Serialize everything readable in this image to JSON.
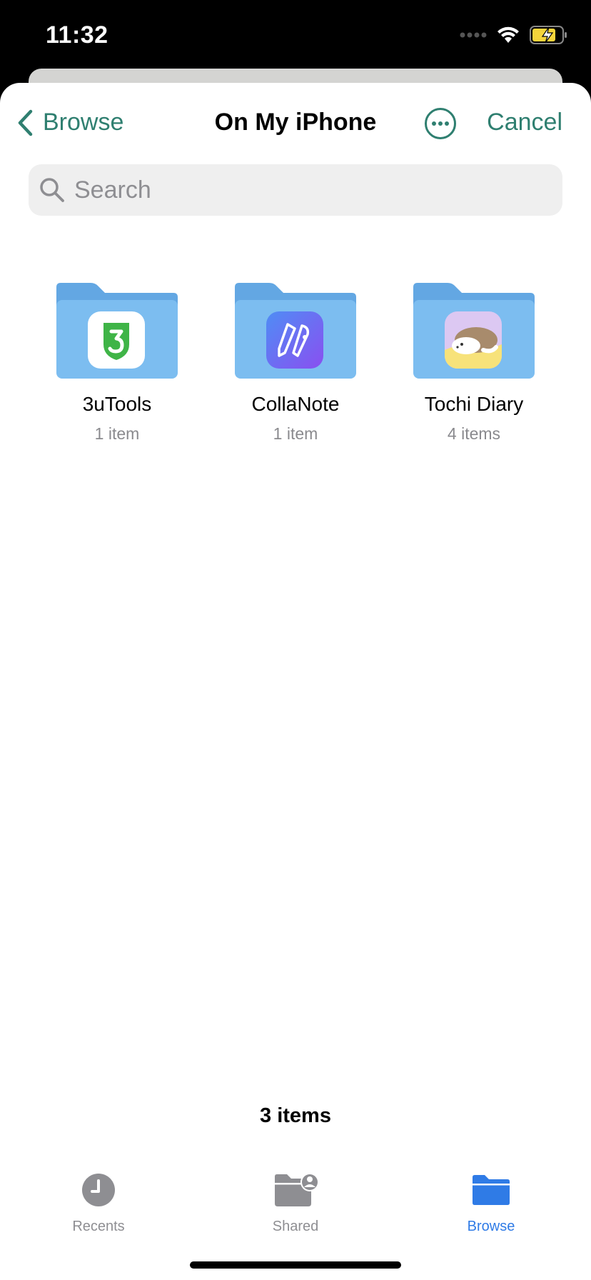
{
  "status_bar": {
    "time": "11:32",
    "icons": [
      "signal-icon",
      "wifi-icon",
      "battery-charging-icon"
    ]
  },
  "nav": {
    "back_label": "Browse",
    "title": "On My iPhone",
    "more_icon": "ellipsis-circle-icon",
    "cancel_label": "Cancel",
    "accent_color": "#2f7f70"
  },
  "search": {
    "placeholder": "Search",
    "value": ""
  },
  "folders": [
    {
      "name": "3uTools",
      "count": "1 item",
      "app_icon": "3utools-app-icon"
    },
    {
      "name": "CollaNote",
      "count": "1 item",
      "app_icon": "collanote-app-icon"
    },
    {
      "name": "Tochi Diary",
      "count": "4 items",
      "app_icon": "tochi-diary-app-icon"
    }
  ],
  "footer": {
    "count_label": "3 items"
  },
  "tabs": [
    {
      "label": "Recents",
      "icon": "clock-icon",
      "active": false
    },
    {
      "label": "Shared",
      "icon": "shared-folder-icon",
      "active": false
    },
    {
      "label": "Browse",
      "icon": "folder-icon",
      "active": true
    }
  ],
  "colors": {
    "folder_blue": "#7cbdf0",
    "tab_active": "#2f7be6",
    "tab_inactive": "#8e8e92"
  }
}
